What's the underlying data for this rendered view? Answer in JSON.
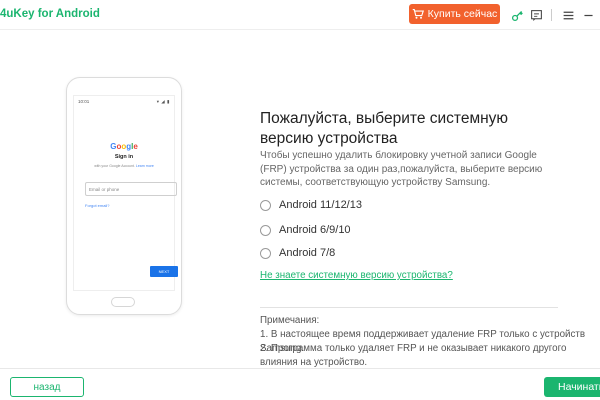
{
  "titlebar": {
    "app_title": "4uKey for Android",
    "buy_label": "Купить сейчас",
    "icons": [
      "cart-icon",
      "key-icon",
      "feedback-icon",
      "menu-icon",
      "minimize-icon"
    ]
  },
  "phone": {
    "status_time": "10:01",
    "status_icons": "▾ ◢ ▮",
    "google_letters": [
      "G",
      "o",
      "o",
      "g",
      "l",
      "e"
    ],
    "signin": "Sign in",
    "signin_sub_text": "with your Google Account.",
    "signin_sub_link": "Learn more",
    "email_placeholder": "Email or phone",
    "forgot": "Forgot email?",
    "next": "NEXT"
  },
  "main": {
    "heading": "Пожалуйста, выберите системную версию устройства",
    "description": "Чтобы успешно удалить блокировку учетной записи Google (FRP) устройства за один раз,пожалуйста, выберите версию системы, соответствующую устройству Samsung.",
    "options": [
      {
        "label": "Android 11/12/13",
        "selected": false
      },
      {
        "label": "Android 6/9/10",
        "selected": false
      },
      {
        "label": "Android 7/8",
        "selected": false
      }
    ],
    "help_link": "Не знаете системную версию устройства?",
    "notes_title": "Примечания:",
    "notes": [
      "1. В настоящее время поддерживает удаление FRP только с устройств Samsung.",
      "2. Программа только удаляет FRP и не оказывает никакого другого влияния на устройство."
    ]
  },
  "footer": {
    "back_label": "назад",
    "start_label": "Начинать"
  },
  "colors": {
    "accent_green": "#1bb56f",
    "buy_orange": "#f2612d"
  }
}
